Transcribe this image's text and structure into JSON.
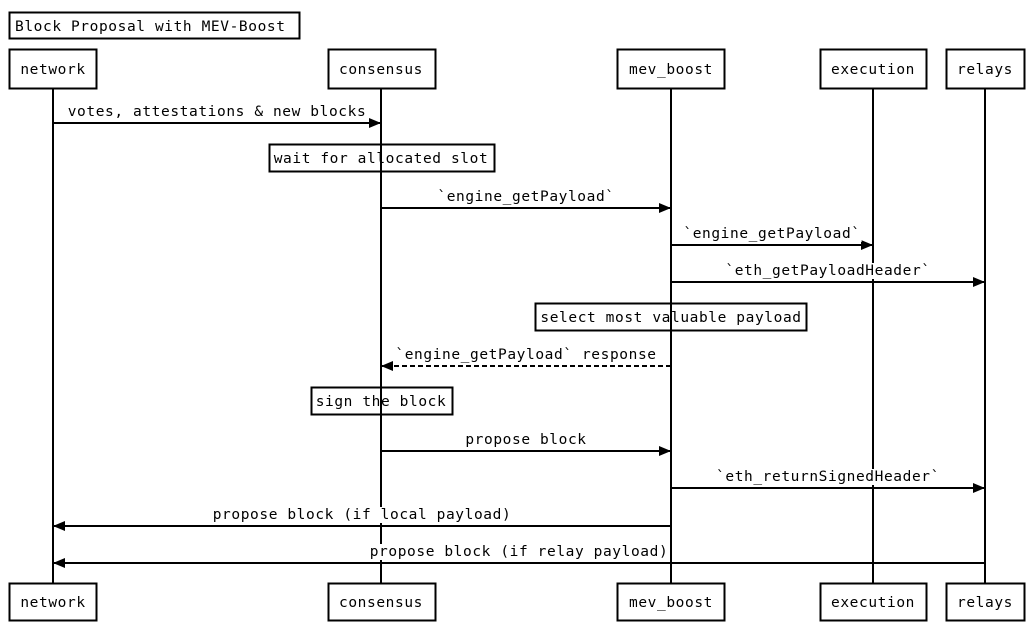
{
  "title": "Block Proposal with MEV-Boost",
  "participants": [
    {
      "id": "network",
      "label": "network"
    },
    {
      "id": "consensus",
      "label": "consensus"
    },
    {
      "id": "mev_boost",
      "label": "mev_boost"
    },
    {
      "id": "execution",
      "label": "execution"
    },
    {
      "id": "relays",
      "label": "relays"
    }
  ],
  "steps": [
    {
      "type": "message",
      "from": "network",
      "to": "consensus",
      "label": "votes, attestations & new blocks",
      "style": "solid"
    },
    {
      "type": "note",
      "over": "consensus",
      "label": "wait for allocated slot"
    },
    {
      "type": "message",
      "from": "consensus",
      "to": "mev_boost",
      "label": "`engine_getPayload`",
      "style": "solid"
    },
    {
      "type": "message",
      "from": "mev_boost",
      "to": "execution",
      "label": "`engine_getPayload`",
      "style": "solid"
    },
    {
      "type": "message",
      "from": "mev_boost",
      "to": "relays",
      "label": "`eth_getPayloadHeader`",
      "style": "solid"
    },
    {
      "type": "note",
      "over": "mev_boost",
      "label": "select most valuable payload"
    },
    {
      "type": "message",
      "from": "mev_boost",
      "to": "consensus",
      "label": "`engine_getPayload` response",
      "style": "dashed"
    },
    {
      "type": "note",
      "over": "consensus",
      "label": "sign the block"
    },
    {
      "type": "message",
      "from": "consensus",
      "to": "mev_boost",
      "label": "propose block",
      "style": "solid"
    },
    {
      "type": "message",
      "from": "mev_boost",
      "to": "relays",
      "label": "`eth_returnSignedHeader`",
      "style": "solid"
    },
    {
      "type": "message",
      "from": "mev_boost",
      "to": "network",
      "label": "propose block (if local payload)",
      "style": "solid"
    },
    {
      "type": "message",
      "from": "relays",
      "to": "network",
      "label": "propose block (if relay payload)",
      "style": "solid"
    }
  ]
}
